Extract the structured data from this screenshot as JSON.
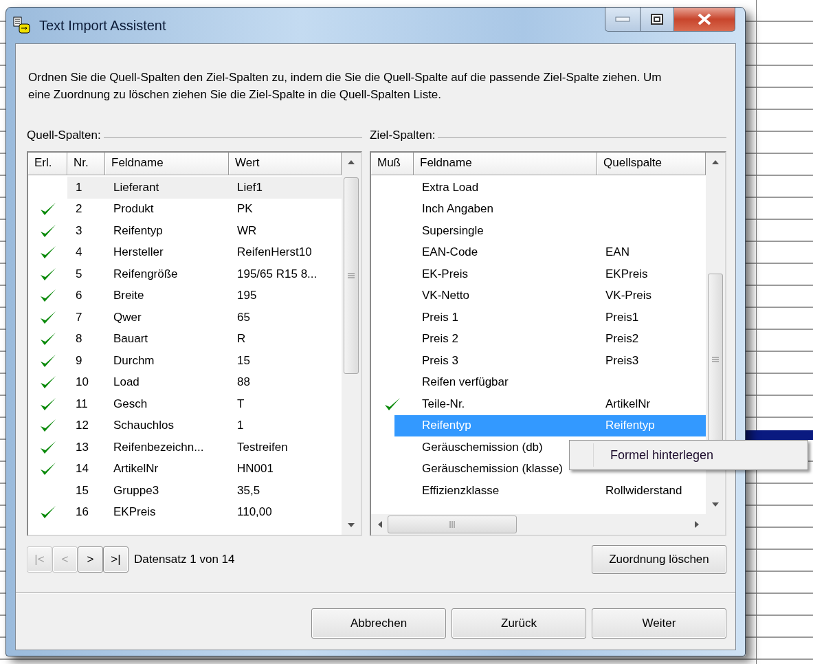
{
  "window": {
    "title": "Text Import Assistent"
  },
  "instructions": "Ordnen Sie die Quell-Spalten den Ziel-Spalten zu, indem die Sie die Quell-Spalte auf die passende Ziel-Spalte ziehen. Um eine Zuordnung zu löschen ziehen Sie die Ziel-Spalte in die Quell-Spalten Liste.",
  "source": {
    "label": "Quell-Spalten:",
    "columns": [
      "Erl.",
      "Nr.",
      "Feldname",
      "Wert"
    ],
    "rows": [
      {
        "checked": false,
        "selected": true,
        "nr": "1",
        "field": "Lieferant",
        "value": "Lief1"
      },
      {
        "checked": true,
        "selected": false,
        "nr": "2",
        "field": "Produkt",
        "value": "PK"
      },
      {
        "checked": true,
        "selected": false,
        "nr": "3",
        "field": "Reifentyp",
        "value": "WR"
      },
      {
        "checked": true,
        "selected": false,
        "nr": "4",
        "field": "Hersteller",
        "value": "ReifenHerst10"
      },
      {
        "checked": true,
        "selected": false,
        "nr": "5",
        "field": "Reifengröße",
        "value": "195/65 R15 8..."
      },
      {
        "checked": true,
        "selected": false,
        "nr": "6",
        "field": "Breite",
        "value": "195"
      },
      {
        "checked": true,
        "selected": false,
        "nr": "7",
        "field": "Qwer",
        "value": "65"
      },
      {
        "checked": true,
        "selected": false,
        "nr": "8",
        "field": "Bauart",
        "value": "R"
      },
      {
        "checked": true,
        "selected": false,
        "nr": "9",
        "field": "Durchm",
        "value": "15"
      },
      {
        "checked": true,
        "selected": false,
        "nr": "10",
        "field": "Load",
        "value": "88"
      },
      {
        "checked": true,
        "selected": false,
        "nr": "11",
        "field": "Gesch",
        "value": "T"
      },
      {
        "checked": true,
        "selected": false,
        "nr": "12",
        "field": "Schauchlos",
        "value": "1"
      },
      {
        "checked": true,
        "selected": false,
        "nr": "13",
        "field": "Reifenbezeichn...",
        "value": "Testreifen"
      },
      {
        "checked": true,
        "selected": false,
        "nr": "14",
        "field": "ArtikelNr",
        "value": "HN001"
      },
      {
        "checked": false,
        "selected": false,
        "nr": "15",
        "field": "Gruppe3",
        "value": "35,5"
      },
      {
        "checked": true,
        "selected": false,
        "nr": "16",
        "field": "EKPreis",
        "value": "110,00"
      }
    ]
  },
  "navigator": {
    "buttons": [
      {
        "label": "|<",
        "disabled": true
      },
      {
        "label": "<",
        "disabled": true
      },
      {
        "label": ">",
        "disabled": false
      },
      {
        "label": ">|",
        "disabled": false
      }
    ],
    "status": "Datensatz 1 von 14"
  },
  "target": {
    "label": "Ziel-Spalten:",
    "columns": [
      "Muß",
      "Feldname",
      "Quellspalte"
    ],
    "rows": [
      {
        "checked": false,
        "selected": false,
        "field": "Extra Load"
      },
      {
        "checked": false,
        "selected": false,
        "field": "Inch Angaben"
      },
      {
        "checked": false,
        "selected": false,
        "field": "Supersingle"
      },
      {
        "checked": false,
        "selected": false,
        "field": "EAN-Code",
        "source": "EAN"
      },
      {
        "checked": false,
        "selected": false,
        "field": "EK-Preis",
        "source": "EKPreis"
      },
      {
        "checked": false,
        "selected": false,
        "field": "VK-Netto",
        "source": "VK-Preis"
      },
      {
        "checked": false,
        "selected": false,
        "field": "Preis 1",
        "source": "Preis1"
      },
      {
        "checked": false,
        "selected": false,
        "field": "Preis 2",
        "source": "Preis2"
      },
      {
        "checked": false,
        "selected": false,
        "field": "Preis 3",
        "source": "Preis3"
      },
      {
        "checked": false,
        "selected": false,
        "field": "Reifen verfügbar"
      },
      {
        "checked": true,
        "selected": false,
        "field": "Teile-Nr.",
        "source": "ArtikelNr"
      },
      {
        "checked": false,
        "selected": true,
        "field": "Reifentyp",
        "source": "Reifentyp"
      },
      {
        "checked": false,
        "selected": false,
        "field": "Geräuschemission (db)"
      },
      {
        "checked": false,
        "selected": false,
        "field": "Geräuschemission (klasse)"
      },
      {
        "checked": false,
        "selected": false,
        "field": "Effizienzklasse",
        "source": "Rollwiderstand"
      }
    ]
  },
  "clear_button": "Zuordnung löschen",
  "buttons": [
    "Abbrechen",
    "Zurück",
    "Weiter"
  ],
  "context_menu": {
    "items": [
      "Formel hinterlegen"
    ]
  }
}
